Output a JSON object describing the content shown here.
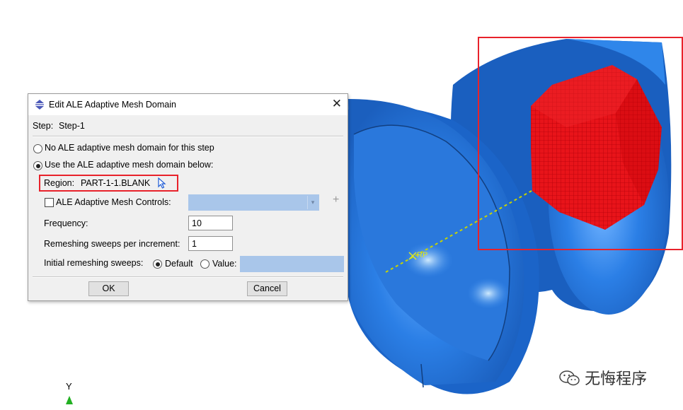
{
  "dialog": {
    "title": "Edit ALE Adaptive Mesh Domain",
    "step_label": "Step:",
    "step_value": "Step-1",
    "option_none": "No ALE adaptive mesh domain for this step",
    "option_use": "Use the ALE adaptive mesh domain below:",
    "region_label": "Region:",
    "region_value": "PART-1-1.BLANK",
    "controls_label": "ALE Adaptive Mesh Controls:",
    "frequency_label": "Frequency:",
    "frequency_value": "10",
    "sweeps_label": "Remeshing sweeps per increment:",
    "sweeps_value": "1",
    "initial_label": "Initial remeshing sweeps:",
    "initial_default": "Default",
    "initial_value": "Value:",
    "ok": "OK",
    "cancel": "Cancel",
    "selected_option": "use",
    "controls_checked": false,
    "initial_selected": "default"
  },
  "viewport": {
    "rp_label": "RP",
    "axis_y": "Y",
    "watermark": "无悔程序"
  },
  "colors": {
    "part": "#1f6fd6",
    "blank": "#e8141a",
    "highlight": "#e8222b",
    "reference_line": "#c8d400",
    "axis": "#22b022"
  }
}
